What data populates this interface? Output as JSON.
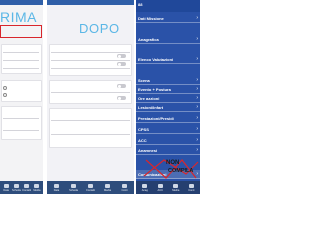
{
  "screens": {
    "before": {
      "title": "RIMA",
      "tabs": [
        {
          "label": "Data",
          "icon": "calendar-icon"
        },
        {
          "label": "Scheda",
          "icon": "card-icon"
        },
        {
          "label": "Contatti",
          "icon": "contacts-icon"
        },
        {
          "label": "Media",
          "icon": "media-icon"
        },
        {
          "label": "Conti",
          "icon": "list-icon"
        }
      ]
    },
    "after": {
      "title": "DOPO",
      "tabs": [
        {
          "label": "Data",
          "icon": "calendar-icon"
        },
        {
          "label": "Scheda",
          "icon": "card-icon"
        },
        {
          "label": "Contatti",
          "icon": "contacts-icon"
        },
        {
          "label": "Media",
          "icon": "media-icon"
        },
        {
          "label": "Conti",
          "icon": "list-icon"
        }
      ]
    },
    "menu": {
      "header": "88",
      "items": [
        {
          "label": "Dati Missione"
        },
        {
          "label": "Anagrafica"
        },
        {
          "label": "Elenco Valutazioni"
        },
        {
          "label": "Scena"
        },
        {
          "label": "Evento + Postura"
        },
        {
          "label": "Ore azzioni"
        },
        {
          "label": "Lesioni/Infart"
        },
        {
          "label": "Prestazioni/Presidi"
        },
        {
          "label": "CPSS"
        },
        {
          "label": "ACC"
        },
        {
          "label": "Anamnesi"
        },
        {
          "label": "Comunicazioni"
        }
      ],
      "annotation": "NON COMPILA",
      "tabs": [
        {
          "label": "Anag",
          "icon": "person-icon"
        },
        {
          "label": "ACC",
          "icon": "heart-icon"
        },
        {
          "label": "Media",
          "icon": "media-icon"
        },
        {
          "label": "Conti",
          "icon": "list-icon"
        }
      ]
    }
  },
  "colors": {
    "title": "#5bb7e6",
    "highlight": "#d8262c",
    "app_blue": "#2a52a8",
    "tabbar": "#2e4d7c"
  }
}
